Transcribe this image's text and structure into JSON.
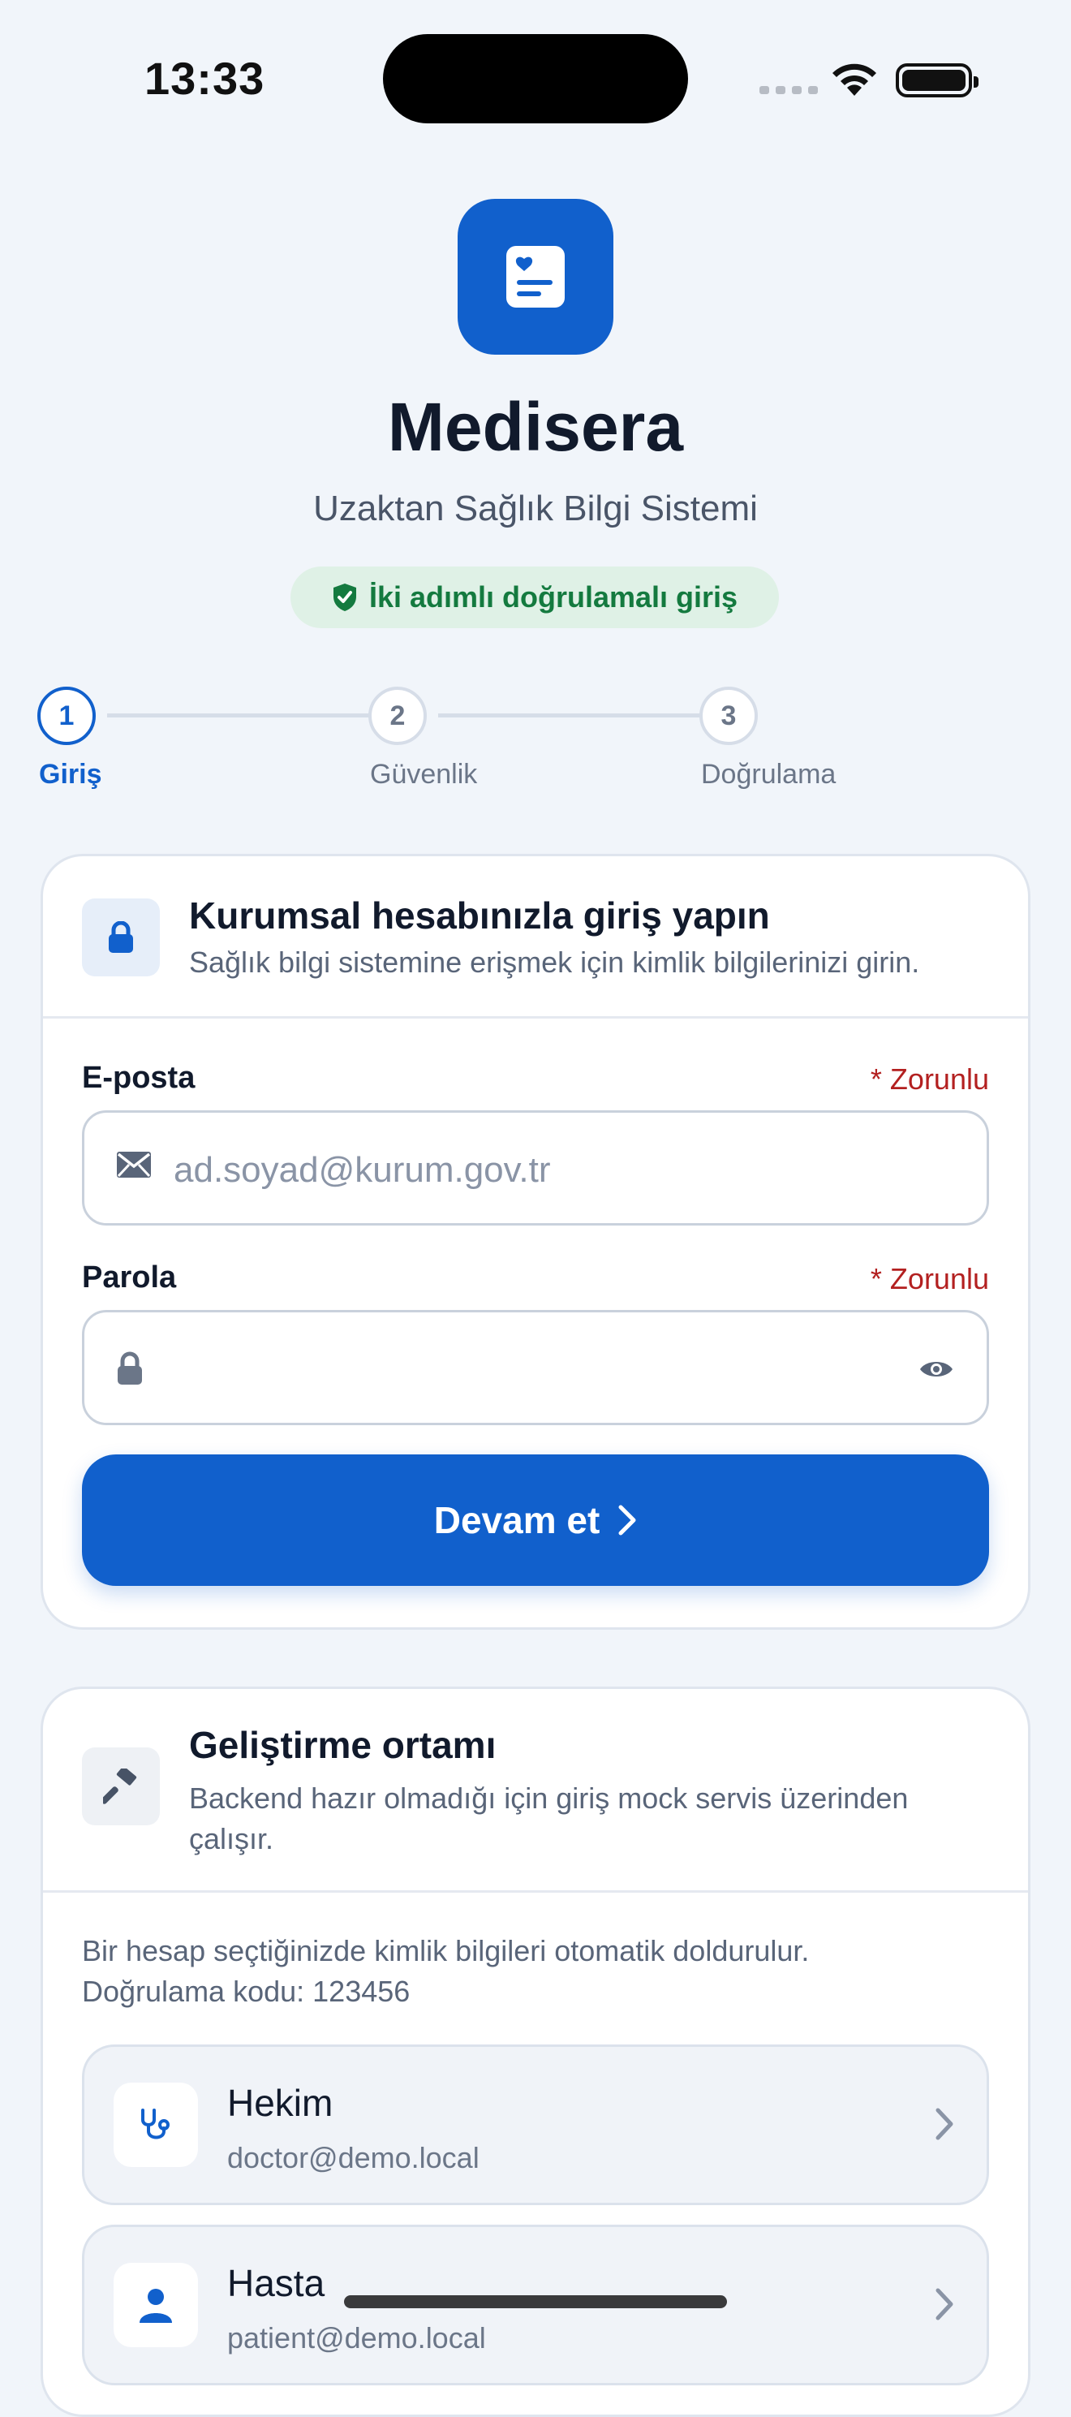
{
  "status_bar": {
    "time": "13:33"
  },
  "header": {
    "app_name": "Medisera",
    "subtitle": "Uzaktan Sağlık Bilgi Sistemi",
    "security_badge": "İki adımlı doğrulamalı giriş",
    "logo_icon": "medical-record-icon"
  },
  "stepper": {
    "steps": [
      {
        "number": "1",
        "label": "Giriş",
        "active": true
      },
      {
        "number": "2",
        "label": "Güvenlik",
        "active": false
      },
      {
        "number": "3",
        "label": "Doğrulama",
        "active": false
      }
    ]
  },
  "login_card": {
    "title": "Kurumsal hesabınızla giriş yapın",
    "description": "Sağlık bilgi sistemine erişmek için kimlik bilgilerinizi girin.",
    "email": {
      "label": "E-posta",
      "required": "* Zorunlu",
      "placeholder": "ad.soyad@kurum.gov.tr",
      "value": ""
    },
    "password": {
      "label": "Parola",
      "required": "* Zorunlu",
      "placeholder": "",
      "value": ""
    },
    "continue_label": "Devam et"
  },
  "dev_card": {
    "title": "Geliştirme ortamı",
    "description_line1": "Backend hazır olmadığı için giriş mock servis üzerinden",
    "description_line2": "çalışır.",
    "note_line1": "Bir hesap seçtiğinizde kimlik bilgileri otomatik doldurulur.",
    "note_line2": "Doğrulama kodu: 123456",
    "accounts": [
      {
        "name": "Hekim",
        "email": "doctor@demo.local",
        "icon": "stethoscope-icon"
      },
      {
        "name": "Hasta",
        "email": "patient@demo.local",
        "icon": "person-icon"
      }
    ]
  },
  "colors": {
    "primary": "#1160cc",
    "background": "#f1f5fa",
    "success_bg": "#dff1e6",
    "success_text": "#147a3f",
    "required": "#b32020"
  }
}
